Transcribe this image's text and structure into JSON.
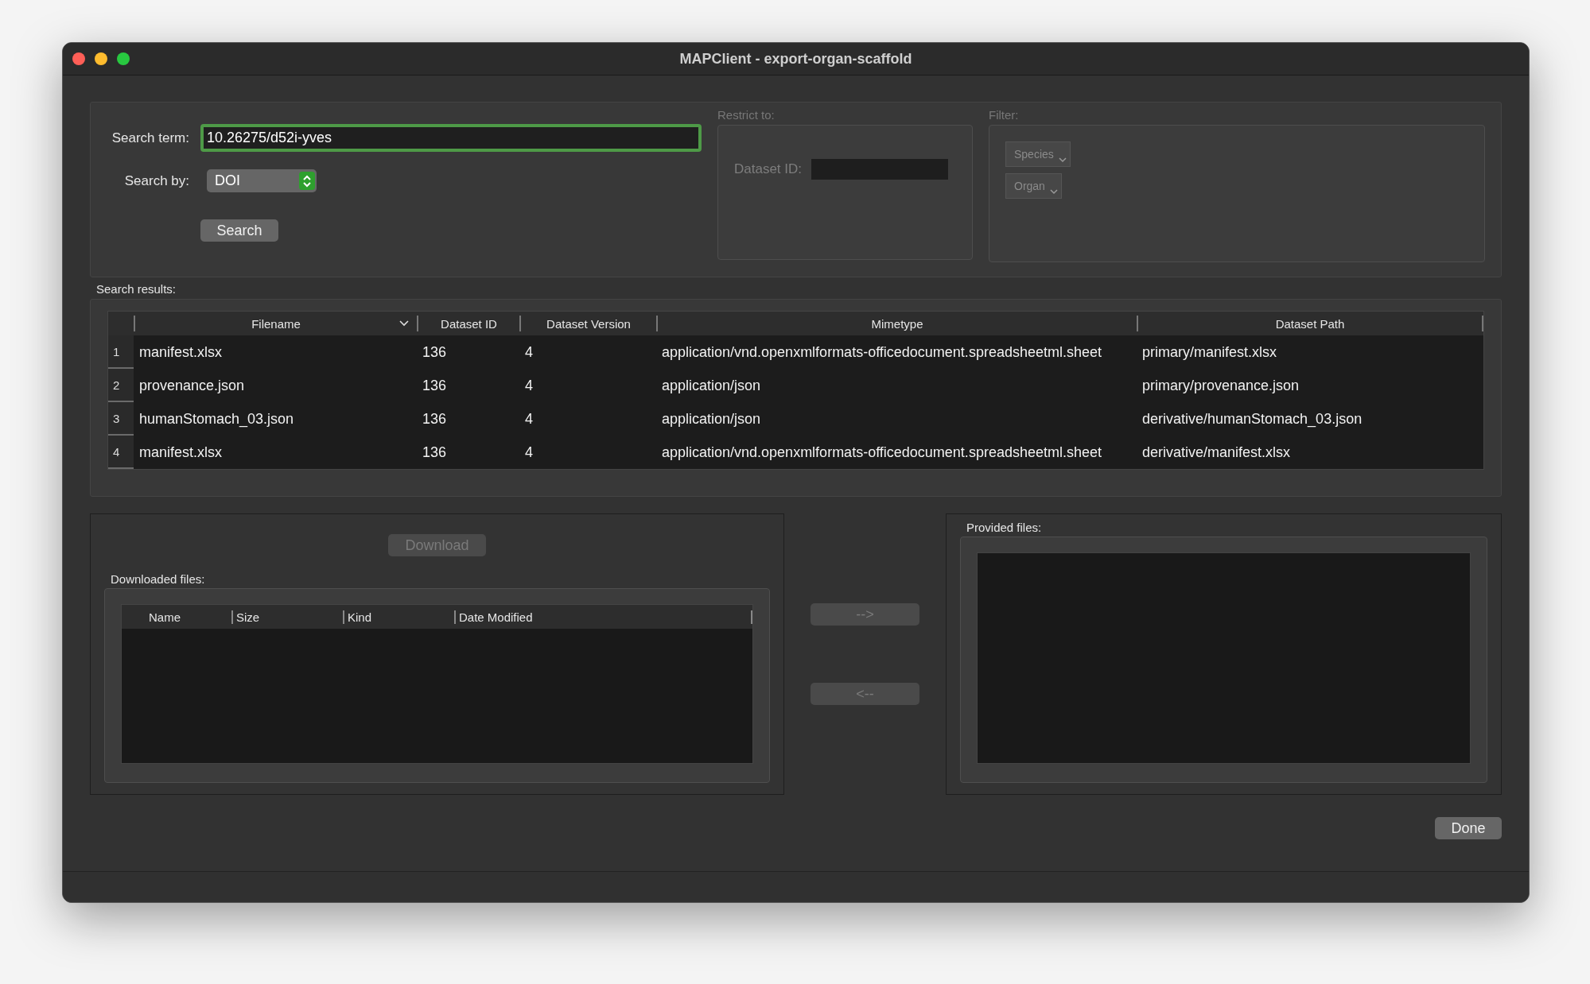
{
  "window": {
    "title": "MAPClient - export-organ-scaffold"
  },
  "search": {
    "term_label": "Search term:",
    "term_value": "10.26275/d52i-yves",
    "focused": true,
    "by_label": "Search by:",
    "by_value": "DOI",
    "button": "Search"
  },
  "restrict": {
    "title": "Restrict to:",
    "dataset_id_label": "Dataset ID:",
    "disabled": true
  },
  "filter": {
    "title": "Filter:",
    "dropdowns": [
      "Species",
      "Organ"
    ],
    "disabled": true
  },
  "results": {
    "title": "Search results:",
    "columns": [
      {
        "label": "Filename",
        "sorted": true
      },
      {
        "label": "Dataset ID",
        "sorted": false
      },
      {
        "label": "Dataset Version",
        "sorted": false
      },
      {
        "label": "Mimetype",
        "sorted": false
      },
      {
        "label": "Dataset Path",
        "sorted": false
      }
    ],
    "rows": [
      {
        "number": "1",
        "cells": [
          "manifest.xlsx",
          "136",
          "4",
          "application/vnd.openxmlformats-officedocument.spreadsheetml.sheet",
          "primary/manifest.xlsx"
        ]
      },
      {
        "number": "2",
        "cells": [
          "provenance.json",
          "136",
          "4",
          "application/json",
          "primary/provenance.json"
        ]
      },
      {
        "number": "3",
        "cells": [
          "humanStomach_03.json",
          "136",
          "4",
          "application/json",
          "derivative/humanStomach_03.json"
        ]
      },
      {
        "number": "4",
        "cells": [
          "manifest.xlsx",
          "136",
          "4",
          "application/vnd.openxmlformats-officedocument.spreadsheetml.sheet",
          "derivative/manifest.xlsx"
        ]
      }
    ]
  },
  "downloads": {
    "button": {
      "label": "Download",
      "disabled": true
    },
    "title": "Downloaded files:",
    "columns": [
      "Name",
      "Size",
      "Kind",
      "Date Modified"
    ]
  },
  "transfer": [
    {
      "label": "-->",
      "disabled": true
    },
    {
      "label": "<--",
      "disabled": true
    }
  ],
  "provided": {
    "title": "Provided files:"
  },
  "done": {
    "label": "Done"
  }
}
